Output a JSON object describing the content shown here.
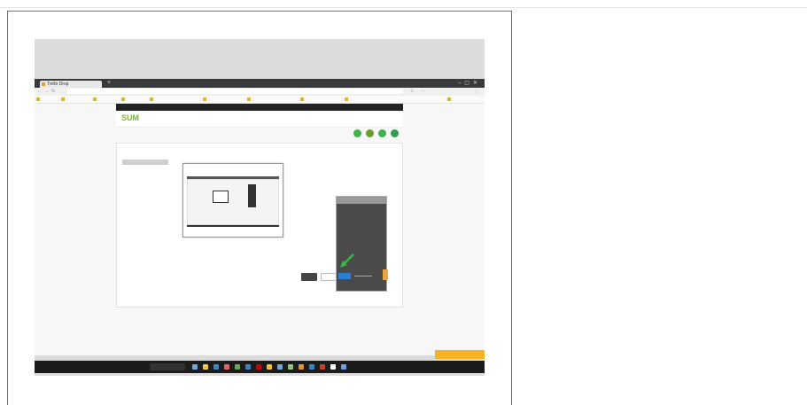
{
  "caption": "",
  "browser": {
    "tab_title": "Trello Drop",
    "url": "  ",
    "bookmarks": [
      "",
      "",
      "",
      "",
      "",
      "",
      "",
      "",
      "",
      ""
    ]
  },
  "site": {
    "logo": "SUM",
    "nav": "",
    "top_left": "",
    "top_right": "",
    "head_right": "",
    "page_title": "",
    "title_right": ""
  },
  "panel": {
    "side_title": "",
    "side_items": [
      "",
      "",
      "",
      ""
    ],
    "crumb": "",
    "save_label": "",
    "cancel_label": "",
    "phone_caption": ""
  },
  "footer": {
    "line1": "",
    "line2": ""
  },
  "float_button": "",
  "taskbar": {
    "weather": "",
    "search": "",
    "tray": ""
  },
  "colors": {
    "accent": "#7cb342",
    "arrow": "#3bb44a",
    "float": "#f6b325",
    "blue": "#2d7fd3"
  }
}
